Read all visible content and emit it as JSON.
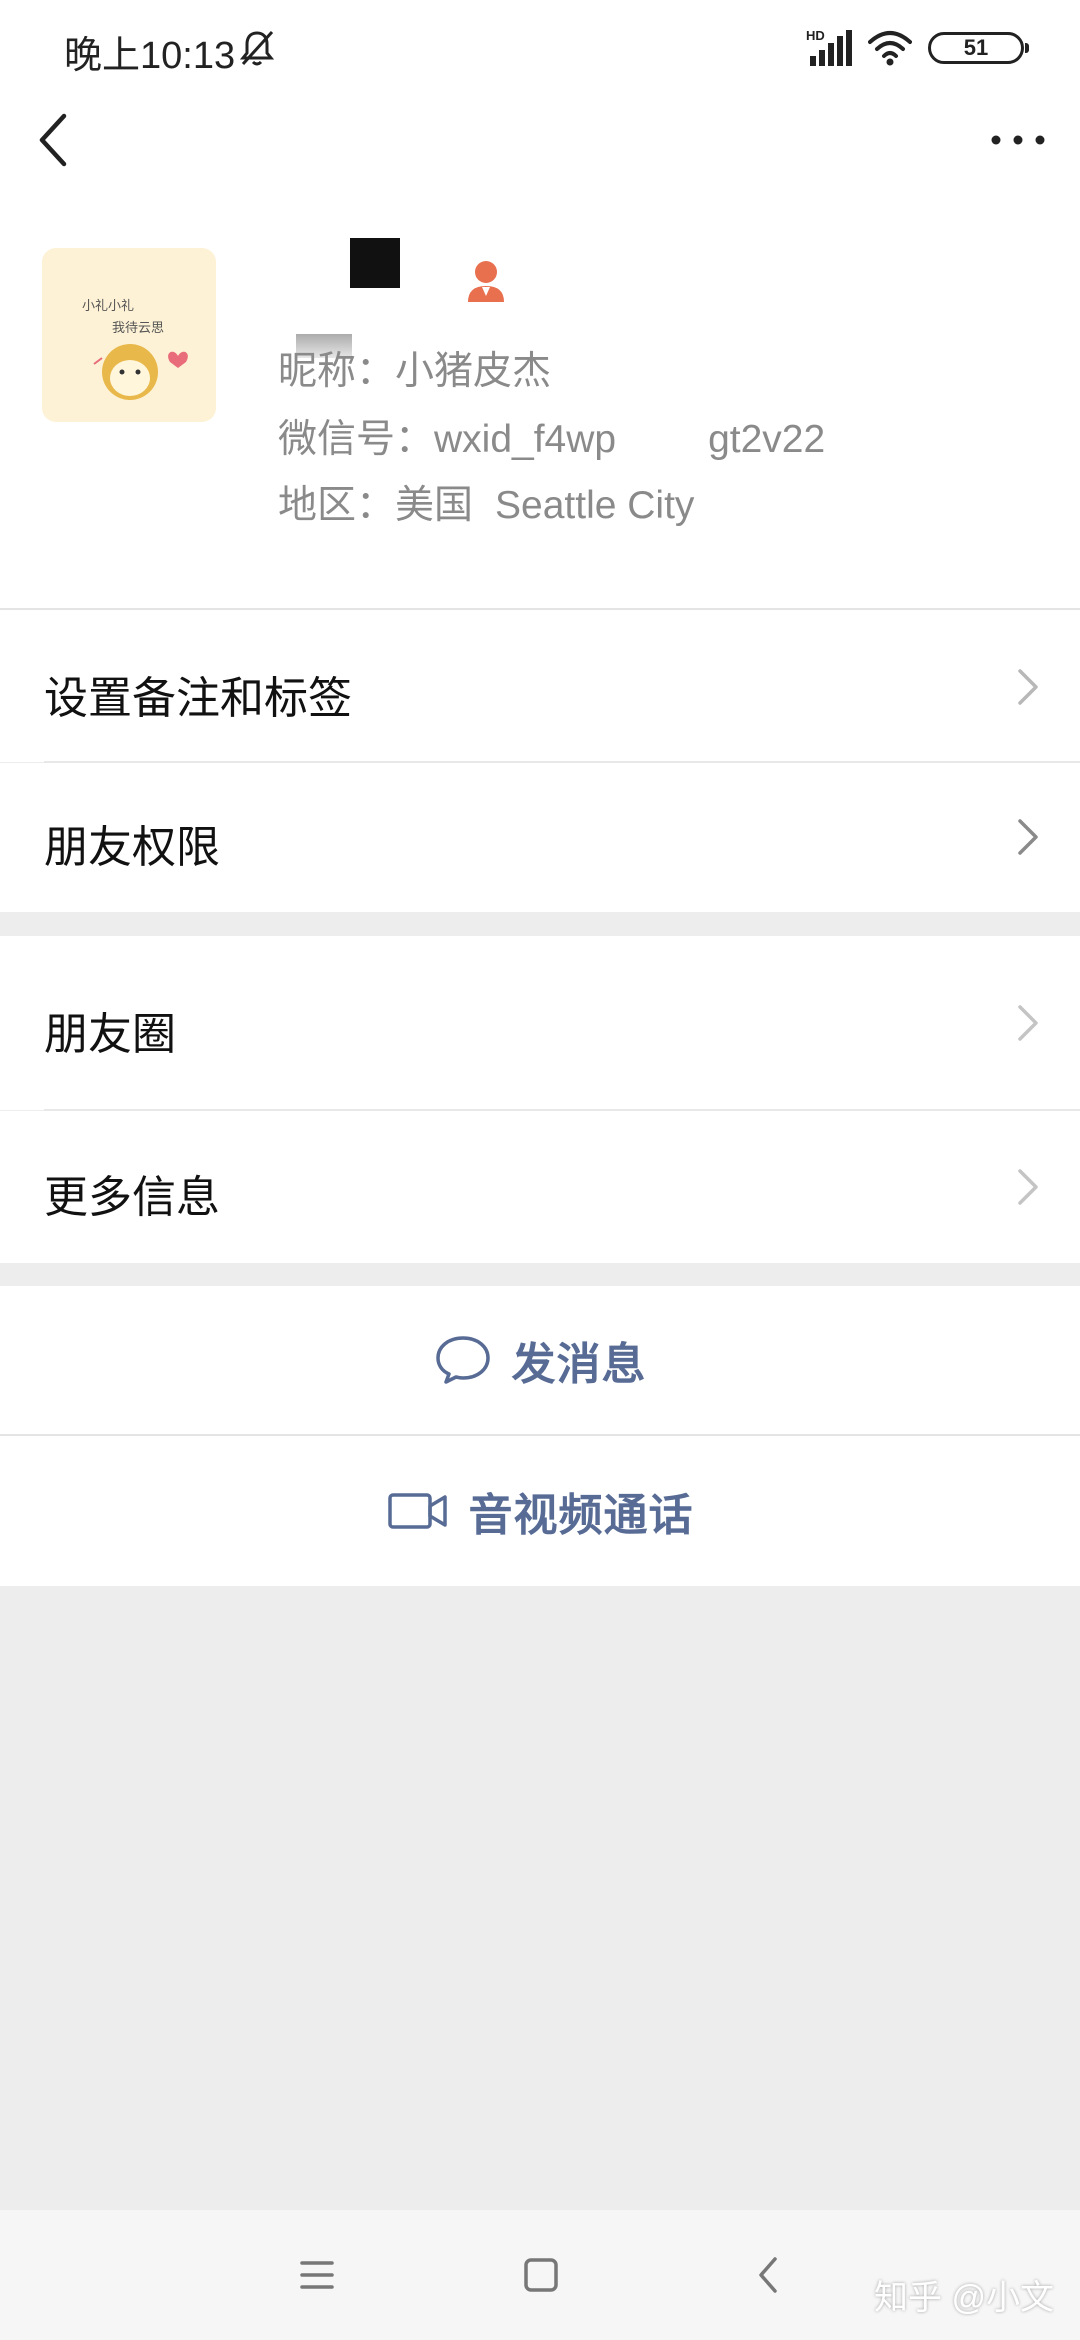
{
  "status_bar": {
    "time": "晚上10:13",
    "network_label": "HD",
    "battery_level": "51"
  },
  "profile": {
    "nickname_line": "昵称：小猪皮杰",
    "wxid_prefix": "微信号：wxid_f4wp",
    "wxid_suffix": "gt2v22",
    "region_prefix": "地区：美国",
    "region_city": "Seattle City",
    "avatar_caption_line1": "小礼小礼",
    "avatar_caption_line2": "我待云思"
  },
  "menu": {
    "remark_tags": "设置备注和标签",
    "friend_permissions": "朋友权限",
    "moments": "朋友圈",
    "more_info": "更多信息"
  },
  "actions": {
    "send_message": "发消息",
    "video_call": "音视频通话"
  },
  "watermark": "知乎 @小文",
  "colors": {
    "link": "#576b95",
    "background": "#ededed",
    "card": "#ffffff"
  }
}
